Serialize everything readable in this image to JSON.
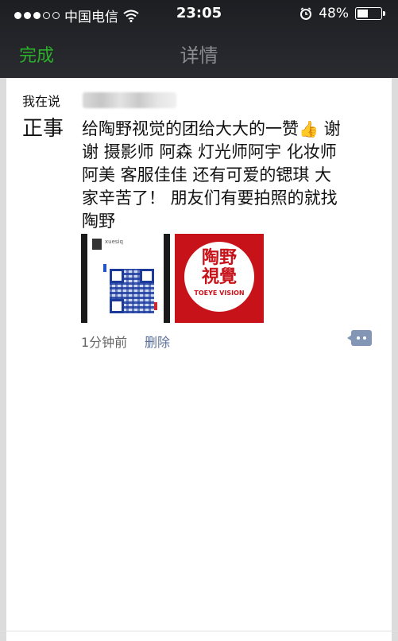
{
  "status_bar": {
    "carrier": "中国电信",
    "time": "23:05",
    "battery": "48%",
    "signal_icon": "signal-dots-icon",
    "wifi_icon": "wifi-icon",
    "alarm_icon": "alarm-icon",
    "battery_icon": "battery-icon",
    "battery_level": 0.48
  },
  "nav": {
    "done_label": "完成",
    "title": "详情"
  },
  "post": {
    "author_prefix": "我在说",
    "author_name": "正事",
    "text_lines": [
      "给陶野视觉的团给大大的一赞",
      "谢 摄影师 阿森 灯光师阿宇 化妆师",
      "阿美 客服佳佳 还有可爱的锶琪 大",
      "家辛苦了！ 朋友们有要拍照的就找",
      "陶野"
    ],
    "text_line1_end": "谢",
    "emoji": "👍",
    "image1": {
      "name_text": "xuesiq"
    },
    "image2": {
      "logo_cn": "陶野\n視覺",
      "logo_cn_line1": "陶野",
      "logo_cn_line2": "視覺",
      "logo_en": "TOEYE VISION"
    },
    "time_ago": "1分钟前",
    "delete_label": "删除",
    "comment_icon": "comment-bubble-icon"
  },
  "colors": {
    "accent_green": "#2bb02b",
    "link_blue": "#5a6f97",
    "brand_red": "#c8121a"
  }
}
